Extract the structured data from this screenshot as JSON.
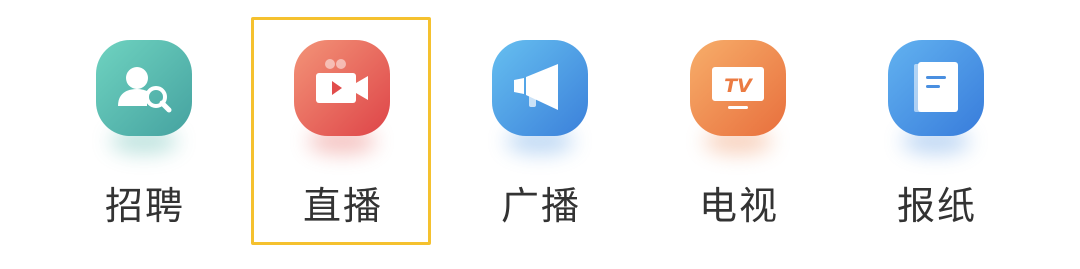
{
  "menu": {
    "items": [
      {
        "label": "招聘",
        "icon": "recruit-search-icon",
        "colors": [
          "#5fc9b6",
          "#4aa9a4"
        ]
      },
      {
        "label": "直播",
        "icon": "live-video-icon",
        "colors": [
          "#f0826d",
          "#e0474a"
        ]
      },
      {
        "label": "广播",
        "icon": "megaphone-icon",
        "colors": [
          "#5db6ee",
          "#3f86dc"
        ]
      },
      {
        "label": "电视",
        "icon": "tv-icon",
        "colors": [
          "#f4a260",
          "#ea7643"
        ]
      },
      {
        "label": "报纸",
        "icon": "newspaper-icon",
        "colors": [
          "#58a5ee",
          "#3a80dc"
        ]
      }
    ],
    "selected_index": 1,
    "selected_border_color": "#f5c12e"
  }
}
